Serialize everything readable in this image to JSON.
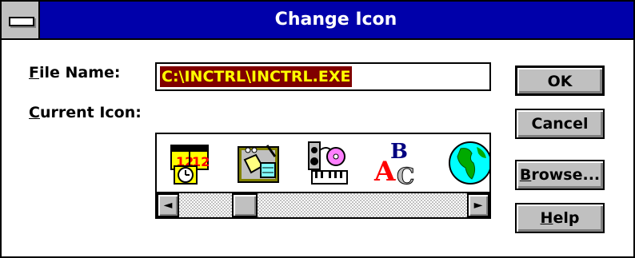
{
  "window": {
    "title": "Change Icon"
  },
  "fields": {
    "file_name_label_prefix": "F",
    "file_name_label_rest": "ile Name:",
    "file_name_value": "C:\\INCTRL\\INCTRL.EXE",
    "current_icon_label_prefix": "C",
    "current_icon_label_rest": "urrent Icon:"
  },
  "icons": [
    "calendar-clock-icon",
    "notepad-pen-icon",
    "multimedia-keyboard-icon",
    "abc-letters-icon",
    "globe-icon"
  ],
  "scrollbar": {
    "left_arrow": "◄",
    "right_arrow": "►",
    "position": 0.2
  },
  "buttons": {
    "ok": "OK",
    "cancel": "Cancel",
    "browse_prefix": "B",
    "browse_rest": "rowse...",
    "help_prefix": "H",
    "help_rest": "elp"
  },
  "colors": {
    "titlebar": "#0000aa",
    "selection_bg": "#800000",
    "selection_fg": "#ffff00",
    "face": "#c0c0c0"
  }
}
